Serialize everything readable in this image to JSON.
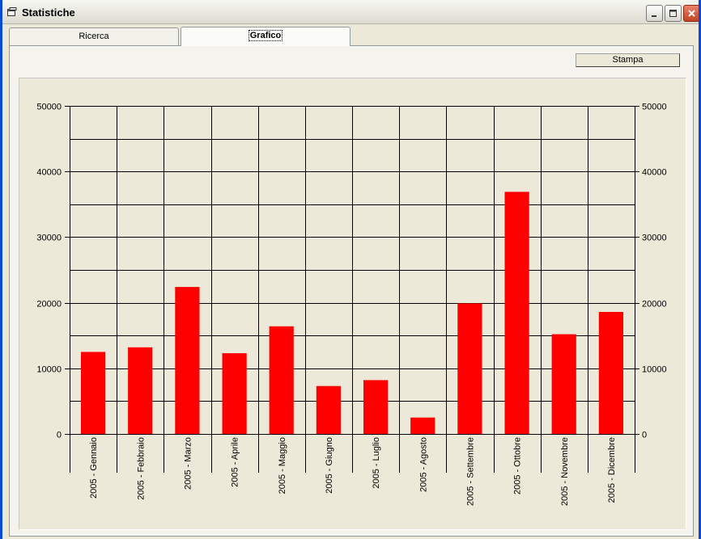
{
  "window": {
    "title": "Statistiche"
  },
  "tabs": [
    {
      "label": "Ricerca"
    },
    {
      "label": "Grafico"
    }
  ],
  "toolbar": {
    "print_label": "Stampa"
  },
  "colors": {
    "bar": "#FF0000",
    "grid": "#000000",
    "background": "#ECE9D8"
  },
  "chart_data": {
    "type": "bar",
    "categories": [
      "2005 - Gennaio",
      "2005 - Febbraio",
      "2005 - Marzo",
      "2005 - Aprile",
      "2005 - Maggio",
      "2005 - Giugno",
      "2005 - Luglio",
      "2005 - Agosto",
      "2005 - Settembre",
      "2005 - Ottobre",
      "2005 - Novembre",
      "2005 - Dicembre"
    ],
    "values": [
      12500,
      13200,
      22400,
      12300,
      16400,
      7300,
      8200,
      2500,
      19900,
      36900,
      15200,
      18600
    ],
    "ylim": [
      0,
      50000
    ],
    "yticks": [
      0,
      10000,
      20000,
      30000,
      40000,
      50000
    ],
    "grid": true,
    "secondary_y_axis": true
  }
}
